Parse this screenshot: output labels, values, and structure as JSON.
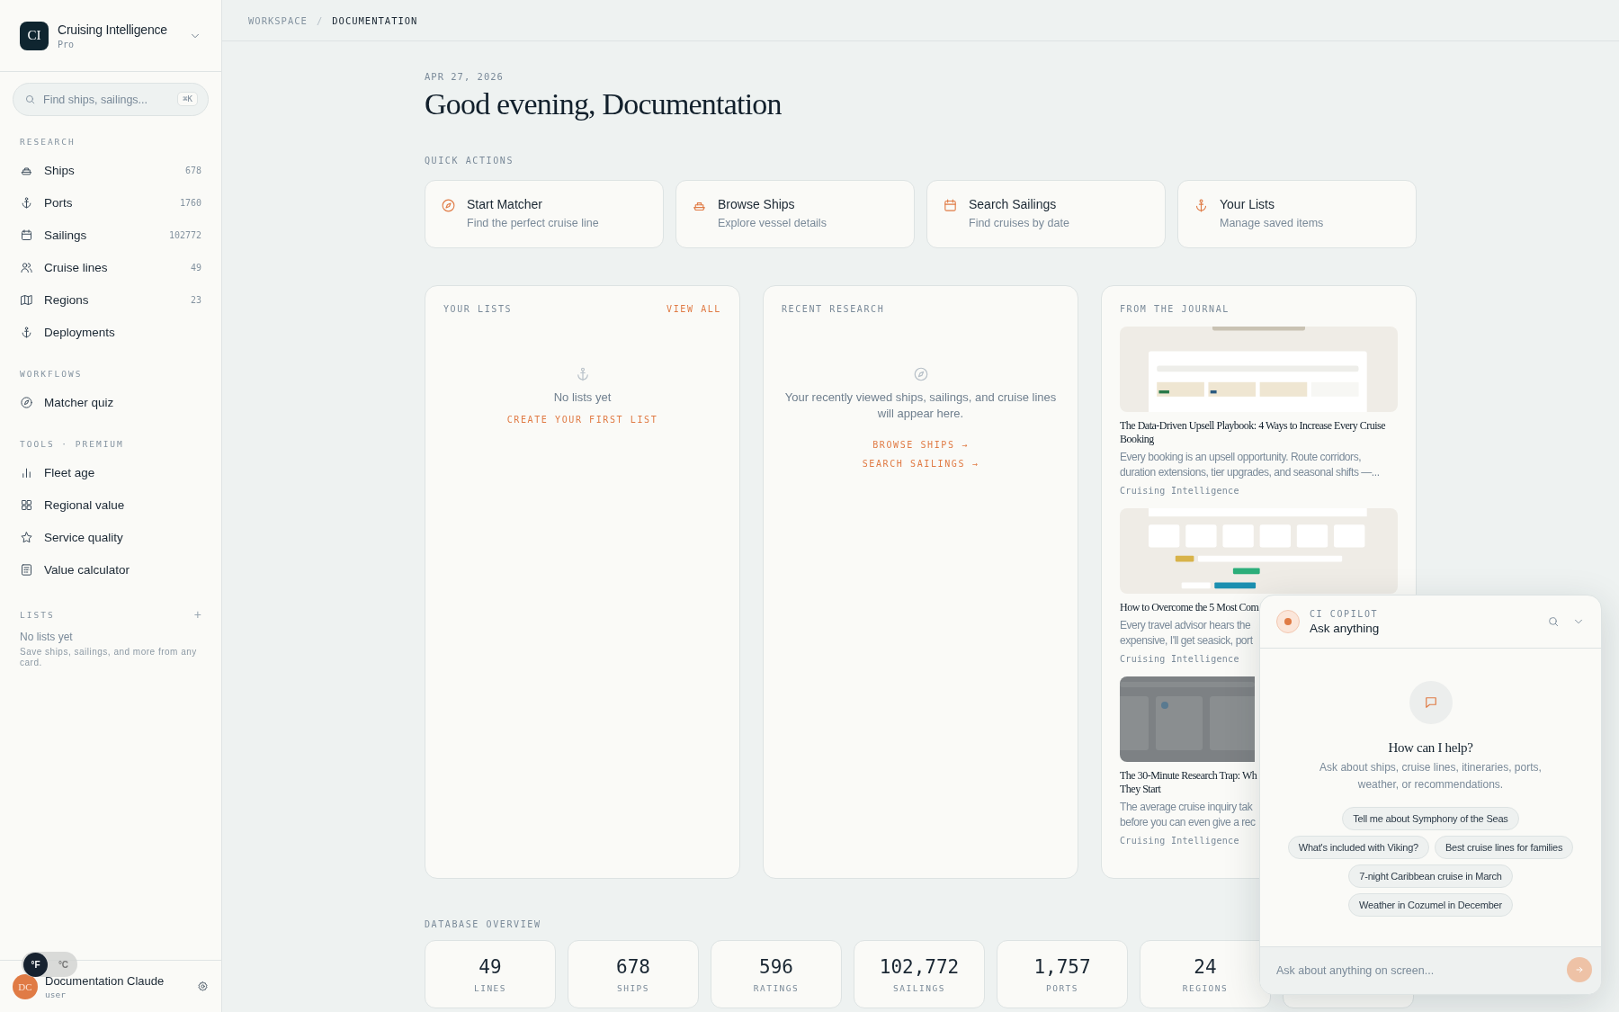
{
  "sidebar": {
    "brand": {
      "logo": "CI",
      "name": "Cruising Intelligence",
      "plan": "Pro"
    },
    "search": {
      "placeholder": "Find ships, sailings...",
      "shortcut": "⌘K"
    },
    "sections": [
      {
        "title": "RESEARCH",
        "items": [
          {
            "label": "Ships",
            "count": "678"
          },
          {
            "label": "Ports",
            "count": "1760"
          },
          {
            "label": "Sailings",
            "count": "102772"
          },
          {
            "label": "Cruise lines",
            "count": "49"
          },
          {
            "label": "Regions",
            "count": "23"
          },
          {
            "label": "Deployments"
          }
        ]
      },
      {
        "title": "WORKFLOWS",
        "items": [
          {
            "label": "Matcher quiz"
          }
        ]
      },
      {
        "title": "TOOLS · PREMIUM",
        "items": [
          {
            "label": "Fleet age"
          },
          {
            "label": "Regional value"
          },
          {
            "label": "Service quality"
          },
          {
            "label": "Value calculator"
          }
        ]
      }
    ],
    "lists": {
      "title": "LISTS",
      "add": "+",
      "empty": "No lists yet",
      "hint": "Save ships, sailings, and more from any card."
    },
    "user": {
      "initials": "DC",
      "name": "Documentation Claude",
      "role": "user"
    },
    "units": [
      {
        "label": "°F",
        "selected": true
      },
      {
        "label": "°C",
        "selected": false
      }
    ]
  },
  "breadcrumb": {
    "items": [
      "WORKSPACE",
      "DOCUMENTATION"
    ],
    "separator": "/"
  },
  "date": "APR 27, 2026",
  "greeting": "Good evening, Documentation",
  "quick_actions": {
    "title": "QUICK ACTIONS",
    "items": [
      {
        "title": "Start Matcher",
        "subtitle": "Find the perfect cruise line"
      },
      {
        "title": "Browse Ships",
        "subtitle": "Explore vessel details"
      },
      {
        "title": "Search Sailings",
        "subtitle": "Find cruises by date"
      },
      {
        "title": "Your Lists",
        "subtitle": "Manage saved items"
      }
    ]
  },
  "your_lists": {
    "title": "YOUR LISTS",
    "link": "VIEW ALL",
    "empty": "No lists yet",
    "action": "CREATE YOUR FIRST LIST"
  },
  "recent_research": {
    "title": "RECENT RESEARCH",
    "empty": "Your recently viewed ships, sailings, and cruise lines will appear here.",
    "links": [
      "BROWSE SHIPS →",
      "SEARCH SAILINGS →"
    ]
  },
  "journal": {
    "title": "FROM THE JOURNAL",
    "articles": [
      {
        "title": "The Data-Driven Upsell Playbook: 4 Ways to Increase Every Cruise Booking",
        "excerpt": "Every booking is an upsell opportunity. Route corridors, duration extensions, tier upgrades, and seasonal shifts —...",
        "source": "Cruising Intelligence"
      },
      {
        "title": "How to Overcome the 5 Most Com",
        "excerpt": "Every travel advisor hears the\nexpensive, I'll get seasick, port",
        "source": "Cruising Intelligence"
      },
      {
        "title": "The 30-Minute Research Trap: Wh\nThey Start",
        "excerpt": "The average cruise inquiry tak\nbefore you can even give a rec",
        "source": "Cruising Intelligence"
      }
    ]
  },
  "database_overview": {
    "title": "DATABASE OVERVIEW",
    "stats": [
      {
        "value": "49",
        "label": "LINES"
      },
      {
        "value": "678",
        "label": "SHIPS"
      },
      {
        "value": "596",
        "label": "RATINGS"
      },
      {
        "value": "102,772",
        "label": "SAILINGS"
      },
      {
        "value": "1,757",
        "label": "PORTS"
      },
      {
        "value": "24",
        "label": "REGIONS"
      }
    ]
  },
  "copilot": {
    "title": "CI COPILOT",
    "subtitle": "Ask anything",
    "prompt_title": "How can I help?",
    "prompt_text": "Ask about ships, cruise lines, itineraries, ports, weather, or recommendations.",
    "suggestions": [
      "Tell me about Symphony of the Seas",
      "What's included with Viking?",
      "Best cruise lines for families",
      "7-night Caribbean cruise in March",
      "Weather in Cozumel in December"
    ],
    "input": {
      "placeholder": "Ask about anything on screen..."
    }
  }
}
